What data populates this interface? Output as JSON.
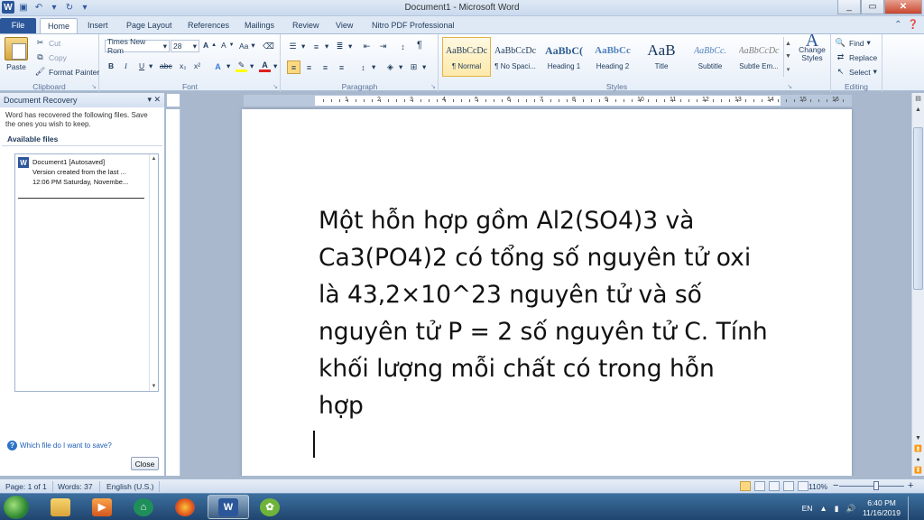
{
  "window": {
    "title": "Document1 - Microsoft Word",
    "min": "_",
    "restore": "▭",
    "close": "✕"
  },
  "tabs": [
    {
      "label": "File"
    },
    {
      "label": "Home"
    },
    {
      "label": "Insert"
    },
    {
      "label": "Page Layout"
    },
    {
      "label": "References"
    },
    {
      "label": "Mailings"
    },
    {
      "label": "Review"
    },
    {
      "label": "View"
    },
    {
      "label": "Nitro PDF Professional"
    }
  ],
  "clipboard": {
    "paste": "Paste",
    "cut": "Cut",
    "copy": "Copy",
    "format_painter": "Format Painter",
    "label": "Clipboard"
  },
  "font": {
    "family": "Times New Rom",
    "size": "28",
    "grow": "A",
    "shrink": "A",
    "change_case": "Aa",
    "bold": "B",
    "italic": "I",
    "underline": "U",
    "strike": "abc",
    "sub": "x₂",
    "sup": "x²",
    "label": "Font"
  },
  "paragraph": {
    "label": "Paragraph",
    "pilcrow": "¶"
  },
  "styles": {
    "label": "Styles",
    "items": [
      {
        "sample": "AaBbCcDc",
        "name": "¶ Normal"
      },
      {
        "sample": "AaBbCcDc",
        "name": "¶ No Spaci..."
      },
      {
        "sample": "AaBbC(",
        "name": "Heading 1"
      },
      {
        "sample": "AaBbCc",
        "name": "Heading 2"
      },
      {
        "sample": "AaB",
        "name": "Title"
      },
      {
        "sample": "AaBbCc.",
        "name": "Subtitle"
      },
      {
        "sample": "AaBbCcDc",
        "name": "Subtle Em..."
      }
    ],
    "change_styles": "Change Styles"
  },
  "editing": {
    "find": "Find",
    "replace": "Replace",
    "select": "Select",
    "label": "Editing"
  },
  "recovery": {
    "header": "Document Recovery",
    "desc": "Word has recovered the following files.  Save the ones you wish to keep.",
    "available": "Available files",
    "file_name": "Document1  [Autosaved]",
    "file_line2": "Version created from the last ...",
    "file_line3": "12:06 PM Saturday, Novembe...",
    "help": "Which file do I want to save?",
    "close": "Close"
  },
  "ruler": {
    "numbers": [
      "1",
      "2",
      "3",
      "4",
      "5",
      "6",
      "7",
      "8",
      "9",
      "10",
      "11",
      "12",
      "13",
      "14",
      "15",
      "16"
    ]
  },
  "document": {
    "lines": [
      "Một hỗn hợp gồm Al2(SO4)3 và",
      "Ca3(PO4)2 có tổng số nguyên tử oxi",
      "là 43,2×10^23 nguyên tử và số",
      "nguyên tử P = 2 số nguyên tử C. Tính",
      "khối lượng mỗi chất có trong hỗn",
      "hợp"
    ]
  },
  "status": {
    "page": "Page: 1 of 1",
    "words": "Words: 37",
    "language": "English (U.S.)",
    "zoom": "110%",
    "zoom_out": "−",
    "zoom_in": "+"
  },
  "taskbar": {
    "lang": "EN",
    "time": "6:40 PM",
    "date": "11/16/2019"
  },
  "colors": {
    "file_tab": "#2b579a",
    "highlight": "#ffff00",
    "font_color": "#e02020"
  }
}
